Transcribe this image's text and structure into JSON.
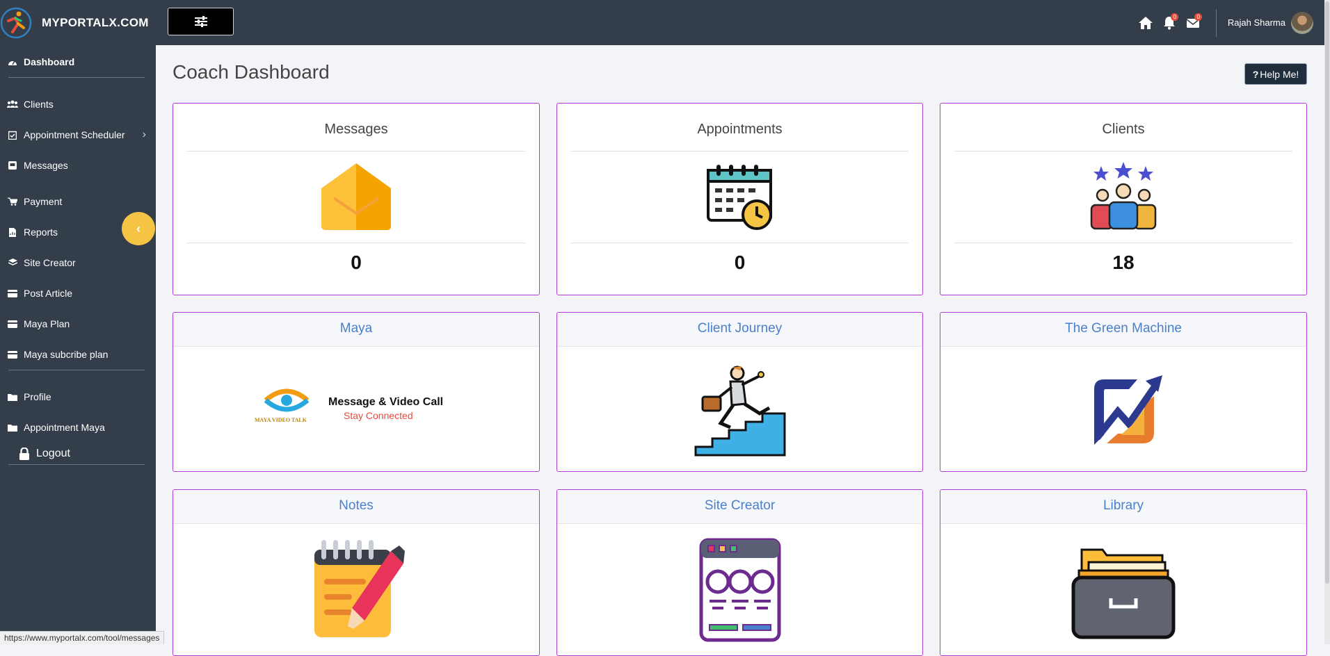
{
  "header": {
    "brand": "MYPORTALX.COM",
    "user_name": "Rajah Sharma",
    "notifications_count": "0",
    "messages_count": "0"
  },
  "sidebar": {
    "items": [
      {
        "label": "Dashboard",
        "icon": "dashboard-icon"
      },
      {
        "label": "Clients",
        "icon": "users-icon"
      },
      {
        "label": "Appointment Scheduler",
        "icon": "calendar-check-icon"
      },
      {
        "label": "Messages",
        "icon": "inbox-icon"
      },
      {
        "label": "Payment",
        "icon": "cart-icon"
      },
      {
        "label": "Reports",
        "icon": "file-chart-icon"
      },
      {
        "label": "Site Creator",
        "icon": "layers-icon"
      },
      {
        "label": "Post Article",
        "icon": "card-icon"
      },
      {
        "label": "Maya Plan",
        "icon": "card-icon"
      },
      {
        "label": "Maya subcribe plan",
        "icon": "card-icon"
      },
      {
        "label": "Profile",
        "icon": "folder-icon"
      },
      {
        "label": "Appointment Maya",
        "icon": "folder-icon"
      },
      {
        "label": "Logout",
        "icon": "lock-icon"
      }
    ]
  },
  "main": {
    "title": "Coach Dashboard",
    "help_label": "Help Me!",
    "stats": [
      {
        "title": "Messages",
        "value": "0"
      },
      {
        "title": "Appointments",
        "value": "0"
      },
      {
        "title": "Clients",
        "value": "18"
      }
    ],
    "tiles": [
      {
        "title": "Maya",
        "logo_text": "MAYA VIDEO TALK",
        "headline": "Message & Video Call",
        "tagline": "Stay Connected"
      },
      {
        "title": "Client Journey"
      },
      {
        "title": "The Green Machine"
      },
      {
        "title": "Notes"
      },
      {
        "title": "Site Creator"
      },
      {
        "title": "Library"
      }
    ]
  },
  "status_bar": {
    "url": "https://www.myportalx.com/tool/messages"
  },
  "colors": {
    "sidebar": "#343e4b",
    "card_border": "#b13bd5",
    "tile_title": "#4a7fc9",
    "collapse": "#f6c445"
  }
}
